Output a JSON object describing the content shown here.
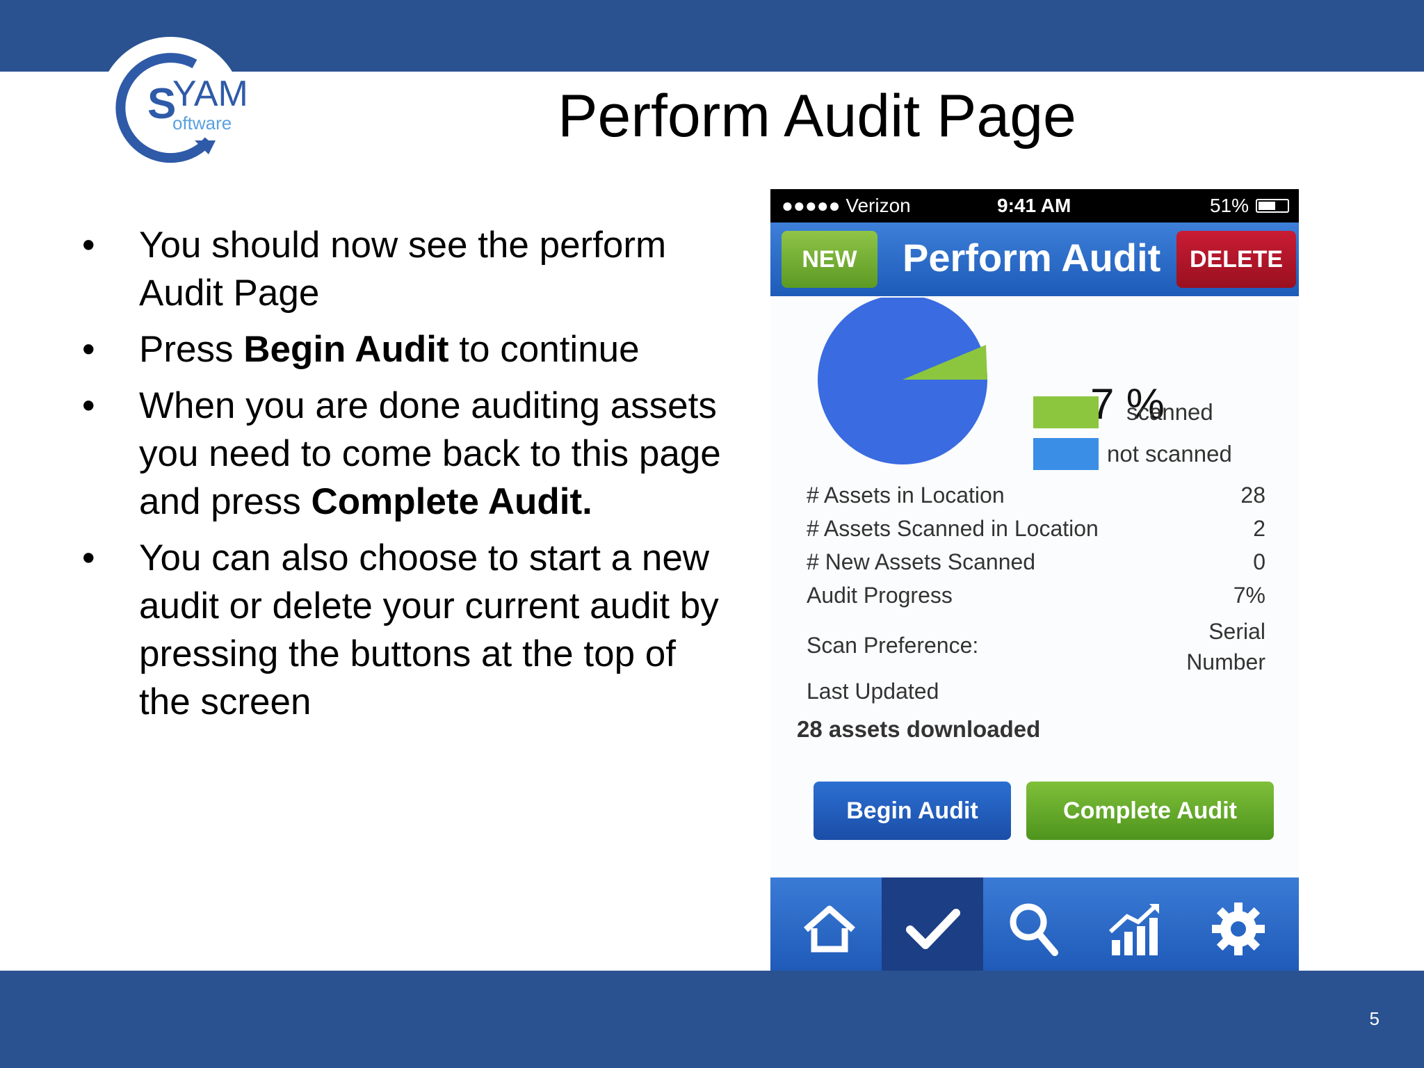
{
  "slide": {
    "title": "Perform Audit Page",
    "page_number": "5",
    "logo": {
      "text_main": "SYAM",
      "text_sub": "oftware"
    },
    "bullets": [
      {
        "parts": [
          {
            "text": "You should now see the perform Audit Page",
            "bold": false
          }
        ]
      },
      {
        "parts": [
          {
            "text": "Press ",
            "bold": false
          },
          {
            "text": "Begin Audit",
            "bold": true
          },
          {
            "text": " to continue",
            "bold": false
          }
        ]
      },
      {
        "parts": [
          {
            "text": "When you are done auditing assets you need to come back to this page and press ",
            "bold": false
          },
          {
            "text": "Complete Audit.",
            "bold": true
          }
        ]
      },
      {
        "parts": [
          {
            "text": "You can also choose to start a new audit or delete your current audit by pressing the buttons at the top of the screen",
            "bold": false
          }
        ]
      }
    ],
    "bullet_char": "•"
  },
  "phone": {
    "status": {
      "carrier": "●●●●● Verizon",
      "time": "9:41 AM",
      "battery": "51%"
    },
    "header": {
      "new_label": "NEW",
      "title": "Perform Audit",
      "delete_label": "DELETE"
    },
    "chart_fragment": "7 %",
    "legend": [
      {
        "label": "scanned",
        "color": "#8cc63f"
      },
      {
        "label": "not scanned",
        "color": "#3a8ee6"
      }
    ],
    "stats": [
      {
        "label": "# Assets in Location",
        "value": "28"
      },
      {
        "label": "# Assets Scanned in Location",
        "value": "2"
      },
      {
        "label": "# New Assets Scanned",
        "value": "0"
      },
      {
        "label": "Audit Progress",
        "value": "7%"
      }
    ],
    "scan_preference": {
      "label": "Scan Preference:",
      "value_line1": "Serial",
      "value_line2": "Number"
    },
    "last_updated": "Last Updated",
    "downloaded": "28 assets downloaded",
    "begin_label": "Begin Audit",
    "complete_label": "Complete Audit",
    "tabs": [
      "home-icon",
      "checkmark-icon",
      "search-icon",
      "chart-icon",
      "gear-icon"
    ]
  },
  "colors": {
    "brand_blue": "#2a5291",
    "pie_blue": "#3a6be0",
    "pie_green": "#8cc63f"
  }
}
